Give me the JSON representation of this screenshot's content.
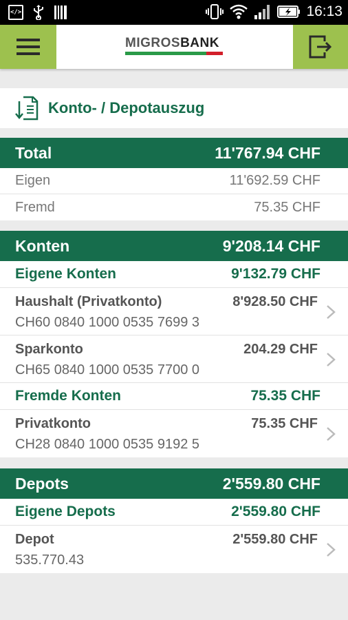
{
  "status_bar": {
    "time": "16:13"
  },
  "app_bar": {
    "logo_part1": "MIGROS",
    "logo_part2": "BANK"
  },
  "page": {
    "title": "Konto- / Depotauszug"
  },
  "total": {
    "label": "Total",
    "amount": "11'767.94 CHF",
    "rows": [
      {
        "label": "Eigen",
        "amount": "11'692.59 CHF"
      },
      {
        "label": "Fremd",
        "amount": "75.35 CHF"
      }
    ]
  },
  "konten": {
    "label": "Konten",
    "amount": "9'208.14 CHF",
    "eigene": {
      "label": "Eigene Konten",
      "amount": "9'132.79 CHF"
    },
    "eigene_accounts": [
      {
        "name": "Haushalt (Privatkonto)",
        "amount": "8'928.50 CHF",
        "iban": "CH60 0840 1000 0535 7699 3"
      },
      {
        "name": "Sparkonto",
        "amount": "204.29 CHF",
        "iban": "CH65 0840 1000 0535 7700 0"
      }
    ],
    "fremde": {
      "label": "Fremde Konten",
      "amount": "75.35 CHF"
    },
    "fremde_accounts": [
      {
        "name": "Privatkonto",
        "amount": "75.35 CHF",
        "iban": "CH28 0840 1000 0535 9192 5"
      }
    ]
  },
  "depots": {
    "label": "Depots",
    "amount": "2'559.80 CHF",
    "eigene": {
      "label": "Eigene Depots",
      "amount": "2'559.80 CHF"
    },
    "accounts": [
      {
        "name": "Depot",
        "amount": "2'559.80 CHF",
        "iban": "535.770.43"
      }
    ]
  },
  "colors": {
    "brand_green": "#166d4c",
    "accent_lime": "#9dc14e",
    "logo_red": "#d21f2a"
  }
}
